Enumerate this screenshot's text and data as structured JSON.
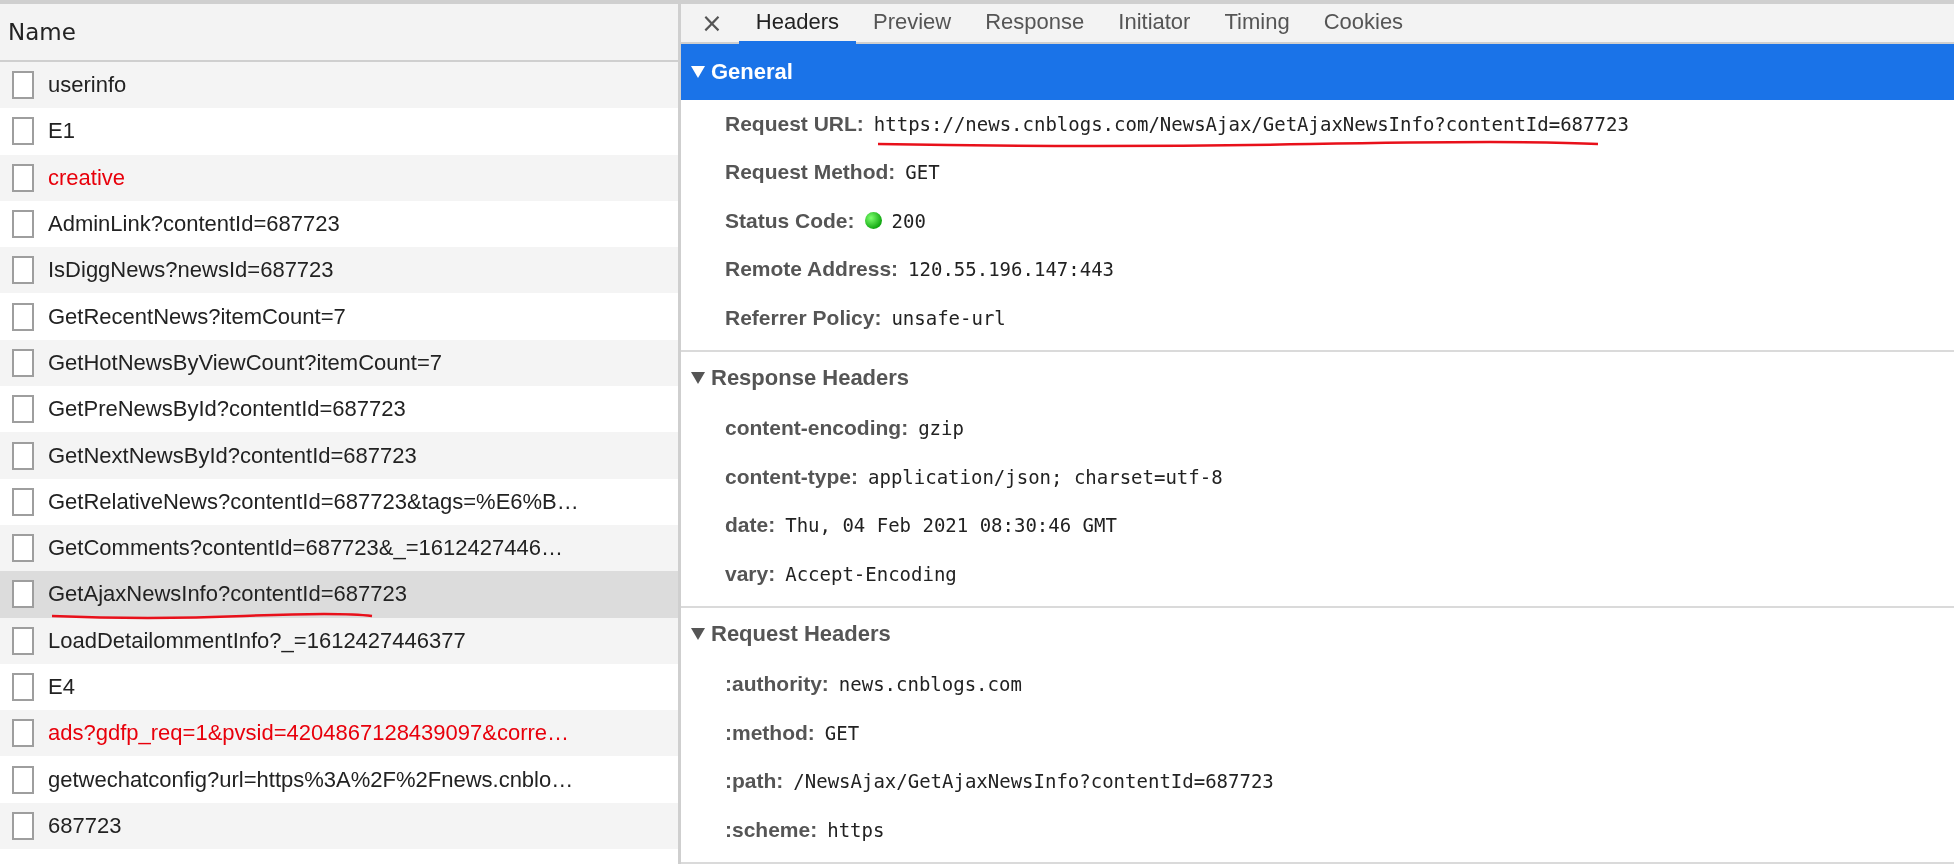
{
  "request_list": {
    "column_header": "Name",
    "rows": [
      {
        "name": "userinfo",
        "failed": false,
        "selected": false,
        "underlined": false
      },
      {
        "name": "E1",
        "failed": false,
        "selected": false,
        "underlined": false
      },
      {
        "name": "creative",
        "failed": true,
        "selected": false,
        "underlined": false
      },
      {
        "name": "AdminLink?contentId=687723",
        "failed": false,
        "selected": false,
        "underlined": false
      },
      {
        "name": "IsDiggNews?newsId=687723",
        "failed": false,
        "selected": false,
        "underlined": false
      },
      {
        "name": "GetRecentNews?itemCount=7",
        "failed": false,
        "selected": false,
        "underlined": false
      },
      {
        "name": "GetHotNewsByViewCount?itemCount=7",
        "failed": false,
        "selected": false,
        "underlined": false
      },
      {
        "name": "GetPreNewsById?contentId=687723",
        "failed": false,
        "selected": false,
        "underlined": false
      },
      {
        "name": "GetNextNewsById?contentId=687723",
        "failed": false,
        "selected": false,
        "underlined": false
      },
      {
        "name": "GetRelativeNews?contentId=687723&tags=%E6%B…",
        "failed": false,
        "selected": false,
        "underlined": false
      },
      {
        "name": "GetComments?contentId=687723&_=1612427446…",
        "failed": false,
        "selected": false,
        "underlined": false
      },
      {
        "name": "GetAjaxNewsInfo?contentId=687723",
        "failed": false,
        "selected": true,
        "underlined": true
      },
      {
        "name": "LoadDetailommentInfo?_=1612427446377",
        "failed": false,
        "selected": false,
        "underlined": false
      },
      {
        "name": "E4",
        "failed": false,
        "selected": false,
        "underlined": false
      },
      {
        "name": "ads?gdfp_req=1&pvsid=4204867128439097&corre…",
        "failed": true,
        "selected": false,
        "underlined": false
      },
      {
        "name": "getwechatconfig?url=https%3A%2F%2Fnews.cnblo…",
        "failed": false,
        "selected": false,
        "underlined": false
      },
      {
        "name": "687723",
        "failed": false,
        "selected": false,
        "underlined": false
      }
    ]
  },
  "detail": {
    "close": "×",
    "tabs": [
      {
        "label": "Headers",
        "selected": true
      },
      {
        "label": "Preview",
        "selected": false
      },
      {
        "label": "Response",
        "selected": false
      },
      {
        "label": "Initiator",
        "selected": false
      },
      {
        "label": "Timing",
        "selected": false
      },
      {
        "label": "Cookies",
        "selected": false
      }
    ],
    "sections": [
      {
        "title": "General",
        "expanded": true,
        "highlighted": true,
        "fields": [
          {
            "kind": "text",
            "key": "Request URL:",
            "value": "https://news.cnblogs.com/NewsAjax/GetAjaxNewsInfo?contentId=687723",
            "underlined": true
          },
          {
            "kind": "text",
            "key": "Request Method:",
            "value": "GET",
            "underlined": false
          },
          {
            "kind": "status",
            "key": "Status Code:",
            "value": "200",
            "underlined": false
          },
          {
            "kind": "text",
            "key": "Remote Address:",
            "value": "120.55.196.147:443",
            "underlined": false
          },
          {
            "kind": "text",
            "key": "Referrer Policy:",
            "value": "unsafe-url",
            "underlined": false
          }
        ]
      },
      {
        "title": "Response Headers",
        "expanded": true,
        "highlighted": false,
        "fields": [
          {
            "kind": "text",
            "key": "content-encoding:",
            "value": "gzip",
            "underlined": false
          },
          {
            "kind": "text",
            "key": "content-type:",
            "value": "application/json; charset=utf-8",
            "underlined": false
          },
          {
            "kind": "text",
            "key": "date:",
            "value": "Thu, 04 Feb 2021 08:30:46 GMT",
            "underlined": false
          },
          {
            "kind": "text",
            "key": "vary:",
            "value": "Accept-Encoding",
            "underlined": false
          }
        ]
      },
      {
        "title": "Request Headers",
        "expanded": true,
        "highlighted": false,
        "fields": [
          {
            "kind": "text",
            "key": ":authority:",
            "value": "news.cnblogs.com",
            "underlined": false
          },
          {
            "kind": "text",
            "key": ":method:",
            "value": "GET",
            "underlined": false
          },
          {
            "kind": "text",
            "key": ":path:",
            "value": "/NewsAjax/GetAjaxNewsInfo?contentId=687723",
            "underlined": false
          },
          {
            "kind": "text",
            "key": ":scheme:",
            "value": "https",
            "underlined": false
          }
        ]
      }
    ]
  }
}
